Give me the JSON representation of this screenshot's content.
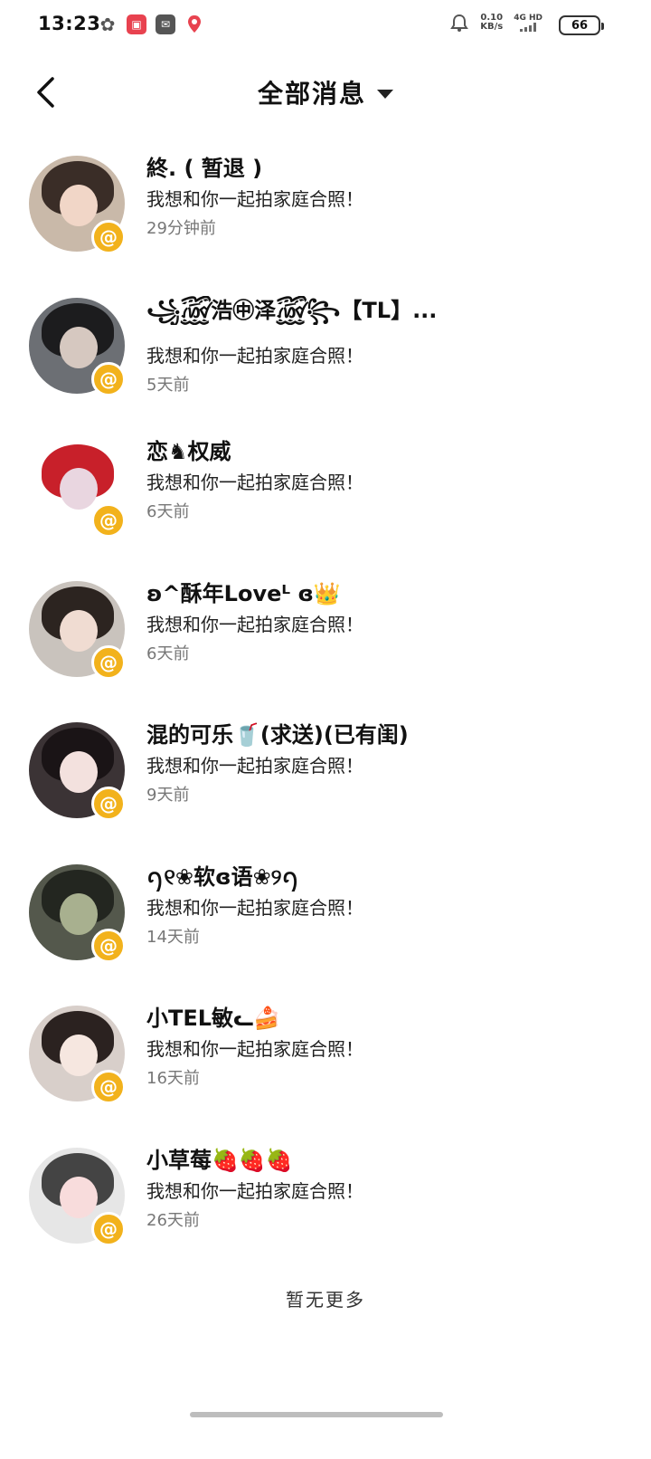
{
  "status_bar": {
    "time": "13:23",
    "network_speed": "0.10",
    "network_unit": "KB/s",
    "network_type": "4G HD",
    "battery_level": "66"
  },
  "header": {
    "title": "全部消息"
  },
  "messages": [
    {
      "name": "終. ( 暂退 )",
      "message": "我想和你一起拍家庭合照！",
      "time": "29分钟前",
      "avatar_colors": [
        "#c9b9a9",
        "#3a2d27",
        "#f1d6c7"
      ]
    },
    {
      "name": "꧁꫞浩㊥泽꫞꧂【TL】...",
      "message": "我想和你一起拍家庭合照！",
      "time": "5天前",
      "avatar_colors": [
        "#6c6f74",
        "#1c1c1e",
        "#d6c8c0"
      ]
    },
    {
      "name": "恋♞权威",
      "message": "我想和你一起拍家庭合照！",
      "time": "6天前",
      "avatar_colors": [
        "#ffffff",
        "#c8202a",
        "#e9d6e0"
      ]
    },
    {
      "name": "ʚ^酥年Loveᴸ ɞ👑",
      "message": "我想和你一起拍家庭合照！",
      "time": "6天前",
      "avatar_colors": [
        "#c9c3bd",
        "#2c2420",
        "#f0dcd2"
      ]
    },
    {
      "name": "混的可乐🥤(求送)(已有闺)",
      "message": "我想和你一起拍家庭合照！",
      "time": "9天前",
      "avatar_colors": [
        "#3b3335",
        "#1a1416",
        "#f3e1de"
      ]
    },
    {
      "name": "ꪆ୧❀软ɞ语❀୨ꪆ",
      "message": "我想和你一起拍家庭合照！",
      "time": "14天前",
      "avatar_colors": [
        "#54584c",
        "#232620",
        "#a8b08f"
      ]
    },
    {
      "name": "小TEL敏ᓚ🍰",
      "message": "我想和你一起拍家庭合照！",
      "time": "16天前",
      "avatar_colors": [
        "#d8cfca",
        "#2b2220",
        "#f6e7e0"
      ]
    },
    {
      "name": "小草莓🍓🍓🍓",
      "message": "我想和你一起拍家庭合照！",
      "time": "26天前",
      "avatar_colors": [
        "#e6e6e6",
        "#444444",
        "#f8dcdc"
      ]
    }
  ],
  "footer": {
    "no_more": "暂无更多"
  }
}
